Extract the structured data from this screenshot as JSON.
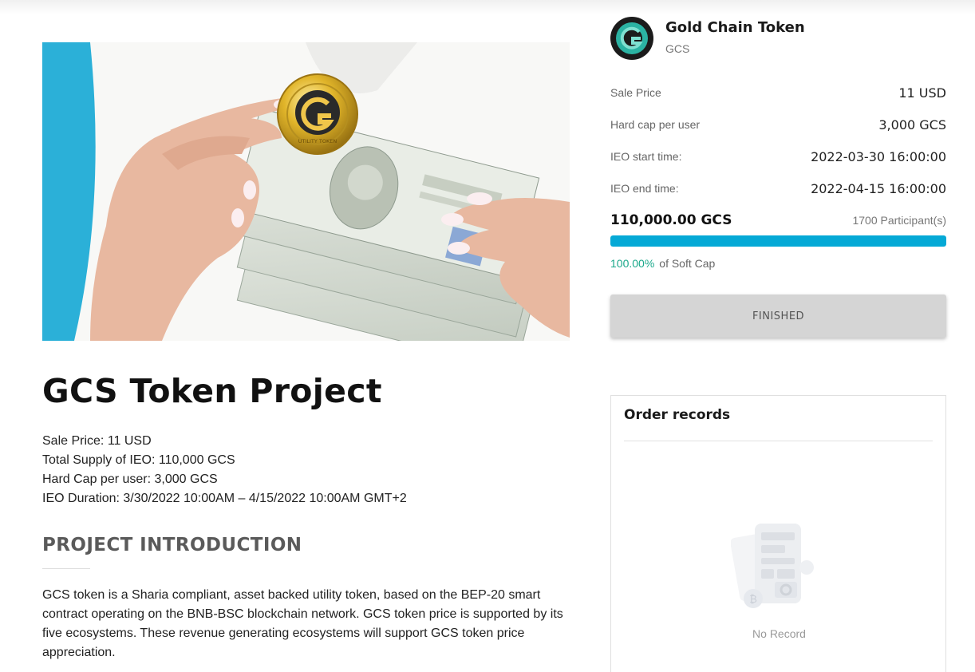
{
  "hero": {
    "coin_text": "UTILITY TOKEN"
  },
  "project": {
    "title": "GCS Token Project",
    "facts": [
      "Sale Price: 11 USD",
      "Total Supply of IEO: 110,000 GCS",
      "Hard Cap per user: 3,000 GCS",
      "IEO Duration: 3/30/2022 10:00AM – 4/15/2022 10:00AM GMT+2"
    ],
    "intro_heading": "PROJECT INTRODUCTION",
    "intro_text": "GCS token is a Sharia compliant, asset backed utility token, based on the BEP-20 smart contract operating on the BNB-BSC blockchain network. GCS token price is supported by its five ecosystems. These revenue generating ecosystems will support GCS token price appreciation."
  },
  "token": {
    "name": "Gold Chain Token",
    "symbol": "GCS"
  },
  "sale_info": [
    {
      "label": "Sale Price",
      "value": "11 USD"
    },
    {
      "label": "Hard cap per user",
      "value": "3,000 GCS"
    },
    {
      "label": "IEO start time:",
      "value": "2022-03-30 16:00:00"
    },
    {
      "label": "IEO end time:",
      "value": "2022-04-15 16:00:00"
    }
  ],
  "progress": {
    "raised": "110,000.00 GCS",
    "participants": "1700 Participant(s)",
    "percent_label": "100.00%",
    "soft_cap_label": "of Soft Cap",
    "fill_fraction": 1.0
  },
  "action": {
    "button_label": "FINISHED"
  },
  "orders": {
    "title": "Order records",
    "empty_label": "No Record"
  },
  "colors": {
    "progress": "#05a9d6",
    "percent": "#1aa88a",
    "hero_bg": "#2bb0d8"
  }
}
